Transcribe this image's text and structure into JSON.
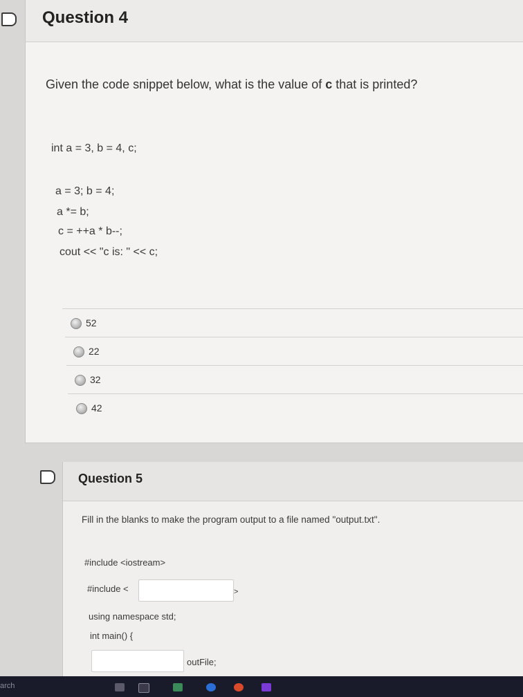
{
  "q4": {
    "title": "Question 4",
    "prompt_before": "Given the code snippet below, what is the value of ",
    "prompt_var": "c",
    "prompt_after": " that is printed?",
    "code": [
      "int a = 3, b = 4, c;",
      "a = 3; b = 4;",
      "a *= b;",
      "c = ++a * b--;",
      "cout << \"c is: \" << c;"
    ],
    "answers": [
      "52",
      "22",
      "32",
      "42"
    ]
  },
  "q5": {
    "title": "Question 5",
    "prompt": "Fill in the blanks to make the program output to a file named \"output.txt\".",
    "line1": "#include <iostream>",
    "line2_prefix": "#include <",
    "line2_suffix": ">",
    "line3": "using namespace std;",
    "line4": "int main() {",
    "line5_suffix": "outFile;"
  },
  "taskbar": {
    "search_label": "arch"
  }
}
